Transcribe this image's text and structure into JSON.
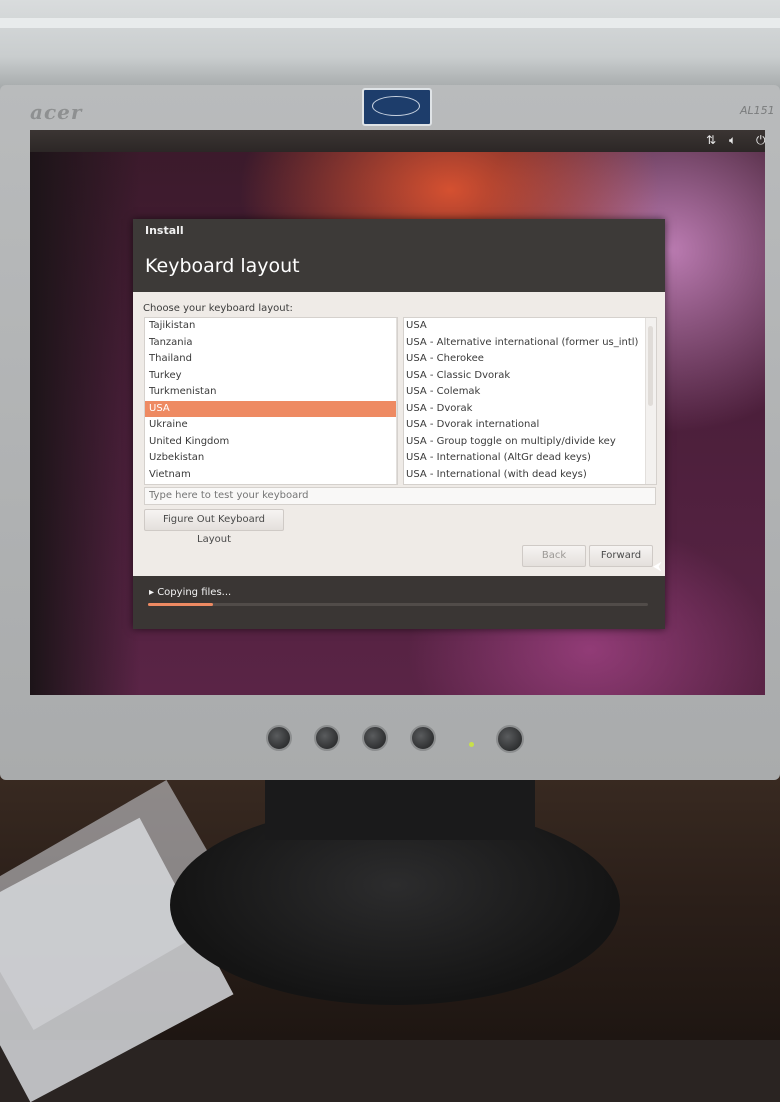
{
  "monitor": {
    "brand": "acer",
    "model": "AL151"
  },
  "tray": {
    "network_icon": "network-arrows-icon",
    "volume_icon": "speaker-icon",
    "power_icon": "power-icon"
  },
  "window": {
    "title": "Install",
    "heading": "Keyboard layout",
    "prompt": "Choose your keyboard layout:",
    "countries": [
      "Tajikistan",
      "Tanzania",
      "Thailand",
      "Turkey",
      "Turkmenistan",
      "USA",
      "Ukraine",
      "United Kingdom",
      "Uzbekistan",
      "Vietnam"
    ],
    "selected_country": "USA",
    "variants": [
      "USA",
      "USA - Alternative international (former us_intl)",
      "USA - Cherokee",
      "USA - Classic Dvorak",
      "USA - Colemak",
      "USA - Dvorak",
      "USA - Dvorak international",
      "USA - Group toggle on multiply/divide key",
      "USA - International (AltGr dead keys)",
      "USA - International (with dead keys)"
    ],
    "test_placeholder": "Type here to test your keyboard",
    "figure_out_label": "Figure Out Keyboard Layout",
    "back_label": "Back",
    "forward_label": "Forward",
    "progress_label": "Copying files...",
    "progress_fraction": 0.13
  },
  "colors": {
    "accent": "#ee8a62",
    "header": "#3d3a38",
    "window_bg": "#efebe7"
  }
}
